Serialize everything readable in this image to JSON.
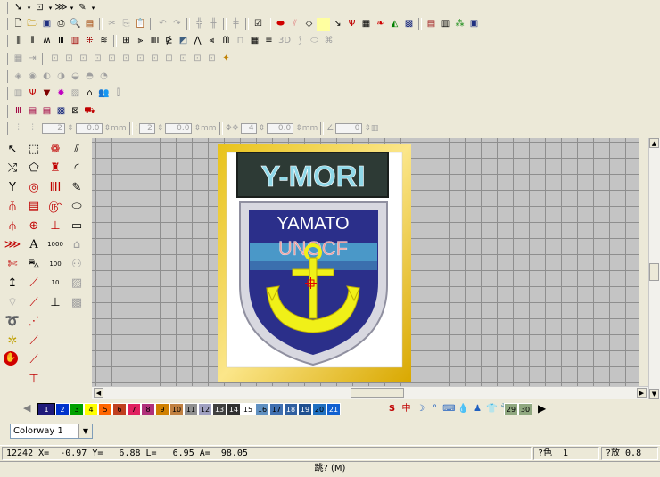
{
  "toolbars": {
    "row1": [
      "pointer-tool",
      "reshape-tool",
      "stitch-tool",
      "pen-tool"
    ],
    "row2_icons": [
      "new-icon",
      "open-icon",
      "save-icon",
      "print-icon",
      "print-preview-icon",
      "import-icon",
      "cut-icon",
      "copy-icon",
      "paste-icon",
      "undo-icon",
      "redo-icon",
      "grid-icon",
      "grid2-icon",
      "checkbox-icon",
      "red-stitch-icon",
      "blue-stitch-icon",
      "outline-icon",
      "yellow-icon",
      "needle-icon",
      "fork-icon",
      "grid3-icon",
      "wings-icon",
      "chart-icon",
      "design-icon",
      "table-icon",
      "table2-icon",
      "tree-icon",
      "picture-icon"
    ],
    "row3_label_3d": "3D"
  },
  "field_row": {
    "field1": "2",
    "field2": "0.0",
    "unit1": "mm",
    "field3": "2",
    "field4": "0.0",
    "unit2": "mm",
    "field5": "4",
    "field6": "0.0",
    "unit3": "mm",
    "field7": "0"
  },
  "design": {
    "banner_text": "Y-MORI",
    "shield_line1": "YAMATO",
    "shield_line2": "UNOCF"
  },
  "left_panel": {
    "a_label": "A",
    "num_1000": "1000",
    "num_100": "100",
    "num_10": "10"
  },
  "palette": {
    "swatches": [
      {
        "n": "1",
        "c": "#1f1a7a"
      },
      {
        "n": "2",
        "c": "#0033cc"
      },
      {
        "n": "3",
        "c": "#00a000"
      },
      {
        "n": "4",
        "c": "#ffff00"
      },
      {
        "n": "5",
        "c": "#ff6600"
      },
      {
        "n": "6",
        "c": "#c04020"
      },
      {
        "n": "7",
        "c": "#e02060"
      },
      {
        "n": "8",
        "c": "#b0307a"
      },
      {
        "n": "9",
        "c": "#d08000"
      },
      {
        "n": "10",
        "c": "#c08040"
      },
      {
        "n": "11",
        "c": "#909090"
      },
      {
        "n": "12",
        "c": "#a0a0c0"
      },
      {
        "n": "13",
        "c": "#404040"
      },
      {
        "n": "14",
        "c": "#303030"
      },
      {
        "n": "15",
        "c": "#ffffff"
      },
      {
        "n": "16",
        "c": "#6090c0"
      },
      {
        "n": "17",
        "c": "#4070b0"
      },
      {
        "n": "18",
        "c": "#3060a0"
      },
      {
        "n": "19",
        "c": "#20508f"
      },
      {
        "n": "20",
        "c": "#2070c0"
      },
      {
        "n": "21",
        "c": "#1060d0"
      }
    ],
    "extra": [
      "29",
      "30"
    ],
    "kanji": "中"
  },
  "colorway": {
    "label": "Colorway 1"
  },
  "status": {
    "coords": "12242 X=  -0.97 Y=   6.88 L=   6.95 A=  98.05",
    "color": "?色  1",
    "zoom": "?放 0.8"
  },
  "prompt": "跳? (M)"
}
